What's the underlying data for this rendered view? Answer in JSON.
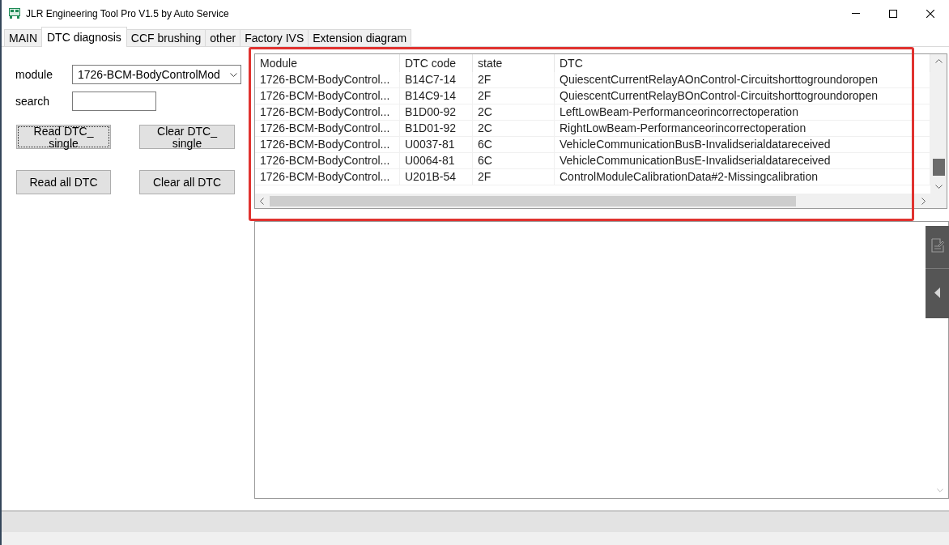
{
  "window": {
    "title": "JLR Engineering Tool Pro V1.5 by Auto Service"
  },
  "tabs": [
    {
      "label": "MAIN",
      "selected": false
    },
    {
      "label": "DTC diagnosis",
      "selected": true
    },
    {
      "label": "CCF brushing",
      "selected": false
    },
    {
      "label": "other",
      "selected": false
    },
    {
      "label": "Factory IVS",
      "selected": false
    },
    {
      "label": "Extension diagram",
      "selected": false
    }
  ],
  "module": {
    "label": "module",
    "value": "1726-BCM-BodyControlMod"
  },
  "search": {
    "label": "search"
  },
  "buttons": [
    {
      "label": "Read DTC_ single",
      "focused": true
    },
    {
      "label": "Clear DTC_ single",
      "focused": false
    },
    {
      "label": "Read all DTC",
      "focused": false
    },
    {
      "label": "Clear all DTC",
      "focused": false
    }
  ],
  "table": {
    "columns": [
      "Module",
      "DTC code",
      "state",
      "DTC"
    ],
    "rows": [
      [
        "1726-BCM-BodyControl...",
        "B14C7-14",
        "2F",
        "QuiescentCurrentRelayAOnControl-Circuitshorttogroundoropen"
      ],
      [
        "1726-BCM-BodyControl...",
        "B14C9-14",
        "2F",
        "QuiescentCurrentRelayBOnControl-Circuitshorttogroundoropen"
      ],
      [
        "1726-BCM-BodyControl...",
        "B1D00-92",
        "2C",
        "LeftLowBeam-Performanceorincorrectoperation"
      ],
      [
        "1726-BCM-BodyControl...",
        "B1D01-92",
        "2C",
        "RightLowBeam-Performanceorincorrectoperation"
      ],
      [
        "1726-BCM-BodyControl...",
        "U0037-81",
        "6C",
        "VehicleCommunicationBusB-Invalidserialdatareceived"
      ],
      [
        "1726-BCM-BodyControl...",
        "U0064-81",
        "6C",
        "VehicleCommunicationBusE-Invalidserialdatareceived"
      ],
      [
        "1726-BCM-BodyControl...",
        "U201B-54",
        "2F",
        "ControlModuleCalibrationData#2-Missingcalibration"
      ]
    ]
  }
}
